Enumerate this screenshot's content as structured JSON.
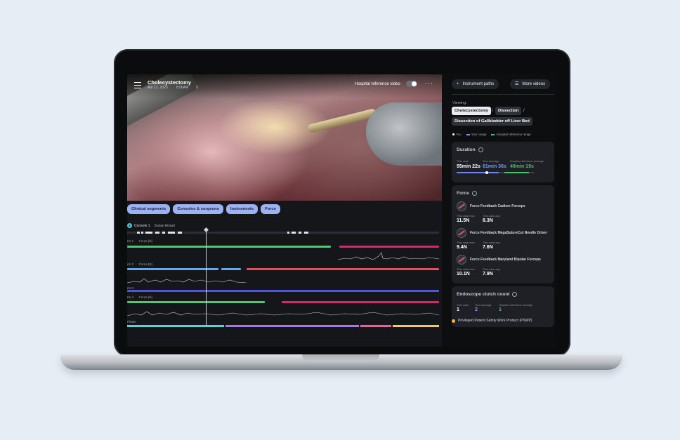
{
  "video": {
    "title": "Cholecystectomy",
    "date": "Apr 12, 2023",
    "time": "8:56AM",
    "extra": "5",
    "reference_label": "Hospital reference video",
    "more": "···"
  },
  "timeline": {
    "pills": [
      "Clinical segments",
      "Consoles & surgeons",
      "Instruments",
      "Force"
    ],
    "console_badge": "2",
    "console_name": "Console 1",
    "console_surgeon": "Susan Ansari",
    "arms": [
      {
        "arm": "rm 1",
        "metric": "Force (N)"
      },
      {
        "arm": "rm 2",
        "metric": "Force (N)"
      },
      {
        "arm": "rm 3",
        "metric": ""
      },
      {
        "arm": "rm 4",
        "metric": "Force (N)"
      }
    ],
    "phase_label": "Phase"
  },
  "panel": {
    "instrument_paths": "Instrument paths",
    "more_videos": "More videos",
    "viewing": "Viewing:",
    "breadcrumb": [
      "Cholecystectomy",
      "Dissection",
      "Dissection of Gallbladder off Liver Bed"
    ],
    "legend": {
      "you": "You",
      "your_range": "Your range",
      "hospital_range": "Hospital reference range"
    },
    "duration": {
      "title": "Duration",
      "this_case_label": "This case",
      "this_case": "55min 22s",
      "your_avg_label": "Your average",
      "your_avg": "61min 36s",
      "hosp_avg_label": "Hospital reference average",
      "hosp_avg": "49min 19s"
    },
    "force": {
      "title": "Force",
      "instruments": [
        {
          "name": "Force Feedback Cadiere Forceps",
          "max_label": "This case max",
          "max": "11.5N",
          "avg_label": "This case avg",
          "avg": "8.3N"
        },
        {
          "name": "Force Feedback MegaSutureCut Needle Driver",
          "max_label": "This case max",
          "max": "9.4N",
          "avg_label": "This case avg",
          "avg": "7.6N"
        },
        {
          "name": "Force Feedback Maryland Bipolar Forceps",
          "max_label": "This case max",
          "max": "10.1N",
          "avg_label": "This case avg",
          "avg": "7.9N"
        }
      ]
    },
    "clutch": {
      "title": "Endoscope clutch count",
      "this_case_label": "This case",
      "this_case": "1",
      "your_avg_label": "Your average",
      "your_avg": "2",
      "hosp_avg_label": "Hospital reference average",
      "hosp_avg": "1"
    },
    "footer": "Privileged Patient Safety Work Product (PSWP)"
  },
  "colors": {
    "pill": "#9db2f2",
    "arm1_green": "#4fc873",
    "arm1_magenta": "#d7286f",
    "arm2_blue": "#6aa7e6",
    "arm2_red": "#e5515a",
    "arm3_blue": "#4b55e0",
    "arm4_green": "#4fc873",
    "arm4_magenta": "#d7286f",
    "you_blue": "#7b97f2",
    "hospital_green": "#49c06c",
    "warning": "#f5b63e"
  }
}
